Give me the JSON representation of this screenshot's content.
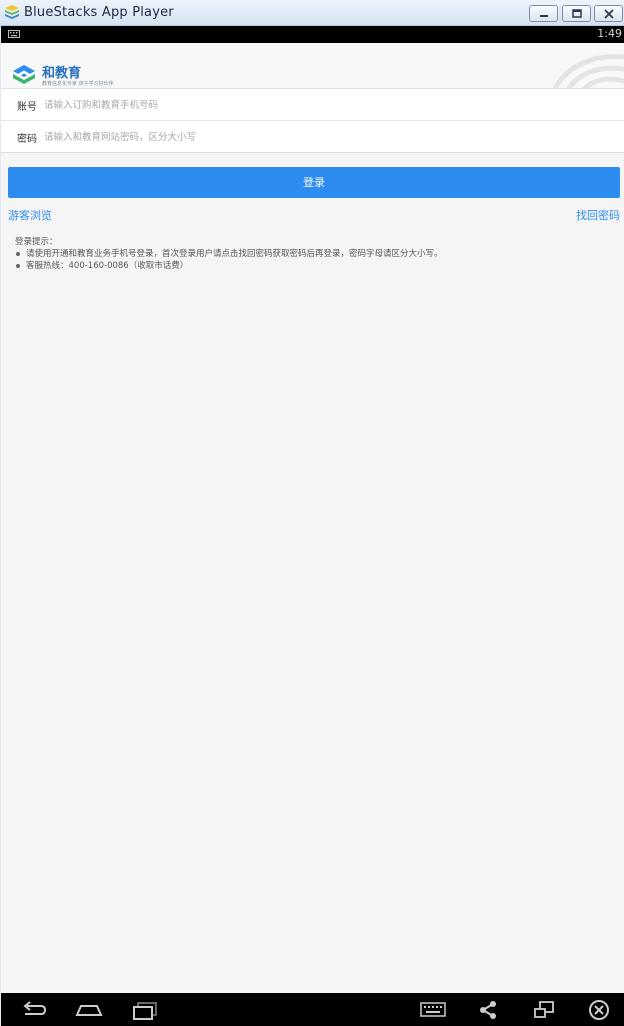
{
  "window": {
    "title": "BlueStacks App Player",
    "controls": [
      "minimize",
      "maximize",
      "close"
    ]
  },
  "status_bar": {
    "time": "1:49",
    "notification_icon": "keyboard-icon"
  },
  "app": {
    "brand": {
      "name": "和教育",
      "slogan": "教育信息化专家 孩子学习好伙伴"
    },
    "form": {
      "account_label": "账号",
      "account_placeholder": "请输入订购和教育手机号码",
      "account_value": "",
      "password_label": "密码",
      "password_placeholder": "请输入和教育网站密码，区分大小写",
      "password_value": ""
    },
    "login_button": "登录",
    "guest_link": "游客浏览",
    "forgot_link": "找回密码",
    "tips": {
      "title": "登录提示：",
      "items": [
        "请使用开通和教育业务手机号登录，首次登录用户请点击找回密码获取密码后再登录，密码字母请区分大小写。",
        "客服热线：400-160-0086（收取市话费）"
      ]
    }
  },
  "colors": {
    "accent": "#2d8cf0",
    "brand_text": "#2a6fc0",
    "logo_green": "#3cb371",
    "logo_blue": "#2d8cf0"
  },
  "nav_bar": {
    "icons": [
      "back-icon",
      "home-icon",
      "recent-apps-icon",
      "keyboard-icon",
      "share-icon",
      "screen-rotate-icon",
      "close-icon"
    ]
  }
}
